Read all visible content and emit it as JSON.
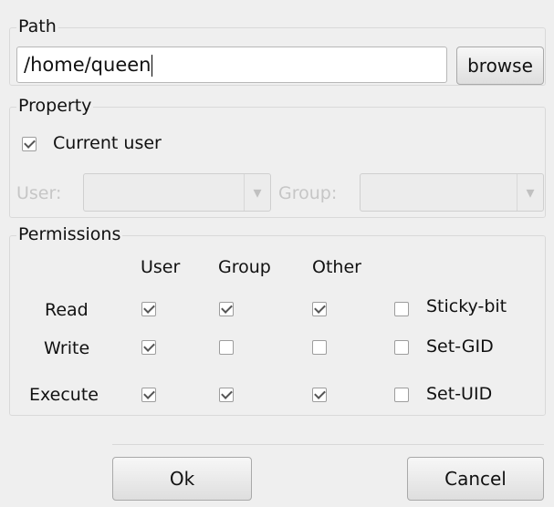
{
  "path": {
    "legend": "Path",
    "value": "/home/queen",
    "browse_label": "browse"
  },
  "property": {
    "legend": "Property",
    "current_user_label": "Current user",
    "current_user_checked": true,
    "user_label": "User:",
    "user_value": "",
    "group_label": "Group:",
    "group_value": ""
  },
  "permissions": {
    "legend": "Permissions",
    "columns": [
      "User",
      "Group",
      "Other"
    ],
    "rows": [
      {
        "label": "Read",
        "user": true,
        "group": true,
        "other": true
      },
      {
        "label": "Write",
        "user": true,
        "group": false,
        "other": false
      },
      {
        "label": "Execute",
        "user": true,
        "group": true,
        "other": true
      }
    ],
    "special": [
      {
        "label": "Sticky-bit",
        "checked": false
      },
      {
        "label": "Set-GID",
        "checked": false
      },
      {
        "label": "Set-UID",
        "checked": false
      }
    ]
  },
  "buttons": {
    "ok_label": "Ok",
    "cancel_label": "Cancel"
  }
}
